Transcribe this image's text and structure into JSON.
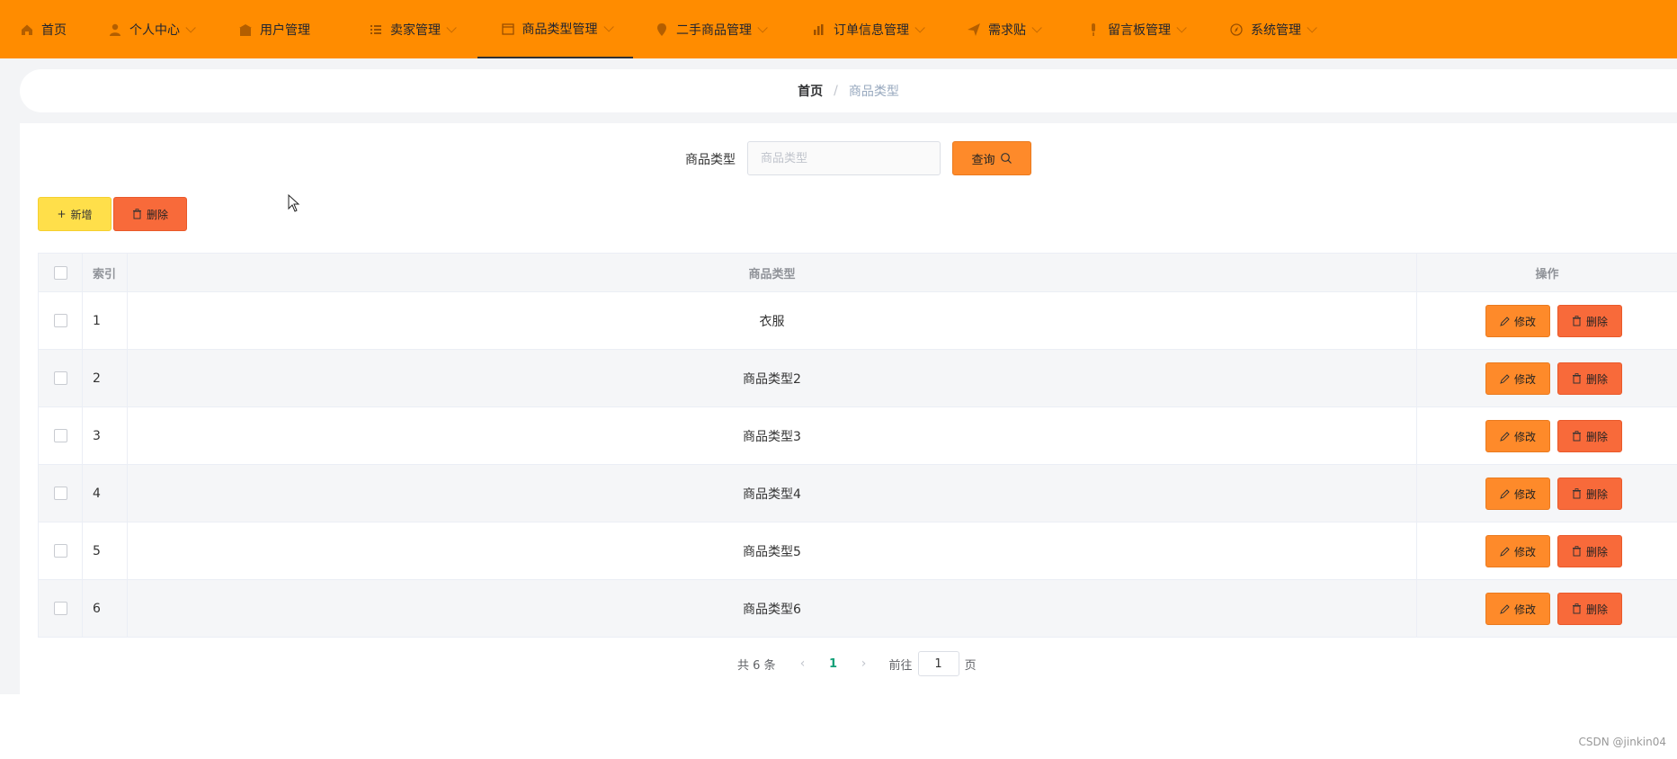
{
  "nav": {
    "items": [
      {
        "label": "首页",
        "icon": "home-icon"
      },
      {
        "label": "个人中心",
        "icon": "user-icon"
      },
      {
        "label": "用户管理",
        "icon": "building-icon"
      },
      {
        "label": "卖家管理",
        "icon": "list-icon"
      },
      {
        "label": "商品类型管理",
        "icon": "calendar-icon"
      },
      {
        "label": "二手商品管理",
        "icon": "location-icon"
      },
      {
        "label": "订单信息管理",
        "icon": "chart-icon"
      },
      {
        "label": "需求贴",
        "icon": "send-icon"
      },
      {
        "label": "留言板管理",
        "icon": "mic-icon"
      },
      {
        "label": "系统管理",
        "icon": "compass-icon"
      }
    ],
    "active": "商品类型管理",
    "bg_color": "#ff8c00"
  },
  "breadcrumb": {
    "home": "首页",
    "separator": "/",
    "current": "商品类型"
  },
  "search": {
    "label": "商品类型",
    "placeholder": "商品类型",
    "value": "",
    "button": "查询"
  },
  "toolbar": {
    "add": "新增",
    "delete": "删除"
  },
  "table": {
    "headers": {
      "index": "索引",
      "type": "商品类型",
      "ops": "操作"
    },
    "rows": [
      {
        "index": "1",
        "type": "衣服"
      },
      {
        "index": "2",
        "type": "商品类型2"
      },
      {
        "index": "3",
        "type": "商品类型3"
      },
      {
        "index": "4",
        "type": "商品类型4"
      },
      {
        "index": "5",
        "type": "商品类型5"
      },
      {
        "index": "6",
        "type": "商品类型6"
      }
    ],
    "edit_label": "修改",
    "delete_label": "删除"
  },
  "pagination": {
    "total": "共 6 条",
    "current_page": "1",
    "goto_label": "前往",
    "goto_value": "1",
    "page_unit": "页"
  },
  "watermark": "CSDN @jinkin04"
}
